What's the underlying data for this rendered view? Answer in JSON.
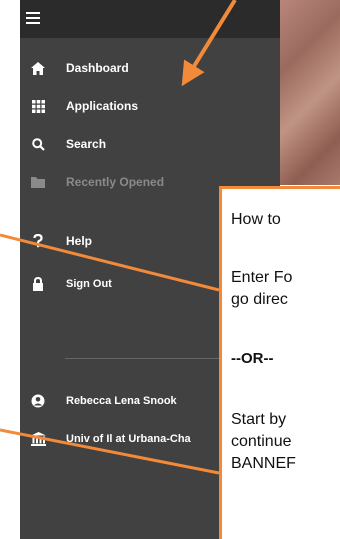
{
  "menu": {
    "items": [
      {
        "label": "Dashboard",
        "icon": "home-icon"
      },
      {
        "label": "Applications",
        "icon": "grid-icon"
      },
      {
        "label": "Search",
        "icon": "search-icon"
      },
      {
        "label": "Recently Opened",
        "icon": "folder-icon"
      },
      {
        "label": "Help",
        "icon": "question-icon"
      },
      {
        "label": "Sign Out",
        "icon": "lock-icon"
      }
    ],
    "user": {
      "label": "Rebecca Lena Snook",
      "icon": "user-circle-icon"
    },
    "institution": {
      "label": "Univ of Il at Urbana-Cha",
      "icon": "institution-icon"
    }
  },
  "callout": {
    "line1": "How to",
    "line2": "Enter Fo",
    "line3": "go direc",
    "line4": "--OR--",
    "line5": "Start by",
    "line6": "continue",
    "line7": "BANNEF"
  },
  "colors": {
    "sidebar": "#414141",
    "topbar": "#2b2b2b",
    "accent": "#f28a3a"
  }
}
